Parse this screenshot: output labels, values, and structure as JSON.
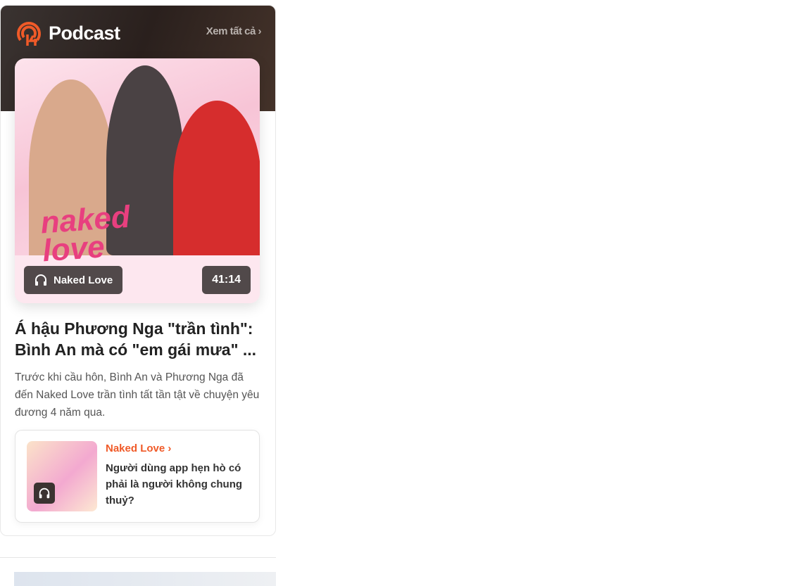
{
  "header": {
    "title": "Podcast",
    "see_all": "Xem tất cả"
  },
  "featured": {
    "cover_brand": "naked love",
    "show_name": "Naked Love",
    "duration": "41:14",
    "title": "Á hậu Phương Nga \"trần tình\": Bình An mà có \"em gái mưa\" ...",
    "description": "Trước khi cầu hôn, Bình An và Phương Nga đã đến Naked Love trần tình tất tần tật về chuyện yêu đương 4 năm qua."
  },
  "related": {
    "show_name": "Naked Love",
    "episode_title": "Người dùng app hẹn hò có phải là người không chung thuỷ?"
  },
  "colors": {
    "accent": "#f05a28",
    "header_bg": "#2a201d"
  }
}
